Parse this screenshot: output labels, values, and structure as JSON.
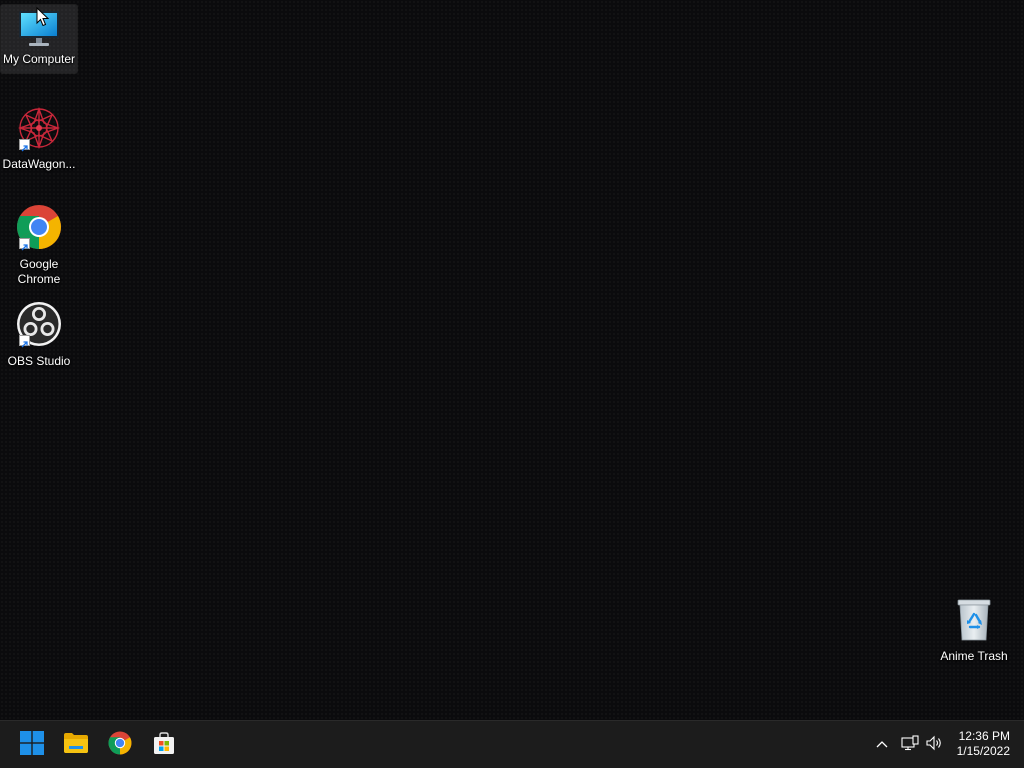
{
  "desktop": {
    "icons": [
      {
        "label": "My Computer",
        "icon": "monitor-icon"
      },
      {
        "label": "DataWagon...",
        "icon": "datawagon-icon"
      },
      {
        "label": "Google Chrome",
        "icon": "chrome-icon"
      },
      {
        "label": "OBS Studio",
        "icon": "obs-icon"
      },
      {
        "label": "Anime Trash",
        "icon": "recycle-bin-icon"
      }
    ]
  },
  "taskbar": {
    "buttons": [
      {
        "name": "start",
        "icon": "windows-logo-icon"
      },
      {
        "name": "file-explorer",
        "icon": "folder-icon"
      },
      {
        "name": "google-chrome",
        "icon": "chrome-icon"
      },
      {
        "name": "microsoft-store",
        "icon": "store-bag-icon"
      }
    ],
    "tray": {
      "icons": [
        "chevron-up-icon",
        "network-icon",
        "volume-icon"
      ],
      "time": "12:36 PM",
      "date": "1/15/2022"
    }
  },
  "colors": {
    "taskbar_bg": "#1c1c1c",
    "desktop_bg": "#0b0b0d",
    "win_blue": "#1e90e8",
    "folder_yellow": "#f5c211",
    "chrome_red": "#db4437",
    "chrome_green": "#0f9d58",
    "chrome_yellow": "#f4b400",
    "chrome_blue": "#4285f4"
  }
}
